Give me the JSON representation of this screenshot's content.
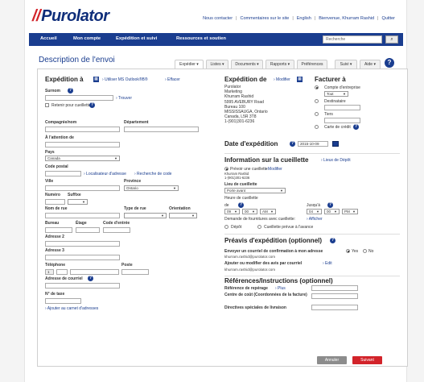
{
  "header": {
    "logo": "Purolator",
    "links": [
      "Nous contacter",
      "Commentaires sur le site",
      "English",
      "Bienvenue, Khurram Rashid",
      "Quitter"
    ]
  },
  "nav": {
    "items": [
      "Accueil",
      "Mon compte",
      "Expédition et suivi",
      "Ressources et soutien"
    ],
    "search_placeholder": "Recherche",
    "search_button": "⌕"
  },
  "page": {
    "title": "Description de l'envoi"
  },
  "tabs": [
    {
      "label": "Expédier ▾",
      "active": true
    },
    {
      "label": "Listes ▾"
    },
    {
      "label": "Documents ▾"
    },
    {
      "label": "Rapports ▾"
    },
    {
      "label": "Préférences"
    },
    {
      "label": "Suivi ▾"
    },
    {
      "label": "Aide ▾"
    }
  ],
  "left": {
    "title": "Expédition à",
    "use_outlook": "› Utiliser MS Outlook®B®",
    "effacer": "› Effacer",
    "surnom": "Surnom",
    "trouver": "› Trouver",
    "retenir": "Retenir pour cueillette",
    "compagnie": "Compagnie/nom",
    "departement": "Département",
    "attention": "À l'attention de",
    "pays": "Pays",
    "pays_value": "Canada",
    "code_postal": "Code postal",
    "localisateur": "› Localisateur d'adresse",
    "recherche_code": "› Recherche de code",
    "ville": "Ville",
    "province": "Province",
    "province_value": "Ontario",
    "numero": "Numéro",
    "suffixe": "Suffixe",
    "nom_rue": "Nom de rue",
    "type_rue": "Type de rue",
    "orientation": "Orientation",
    "bureau": "Bureau",
    "etage": "Étage",
    "code_entree": "Code d'entrée",
    "adresse2": "Adresse 2",
    "adresse3": "Adresse 3",
    "telephone": "Téléphone",
    "tel_prefix": "1",
    "poste": "Poste",
    "courriel": "Adresse de courriel",
    "taxe": "N° de taxe",
    "ajouter": "› Ajouter au carnet d'adresses"
  },
  "sender": {
    "title": "Expédition de",
    "modifier": "› Modifier",
    "address": "Purolator\nMarketing\nKhurram Rashid\n5995 AVEBURY Road\nBureau 100\nMISSISSAUGA, Ontario\nCanada, L5R 3T8\n1-(901)301-6236"
  },
  "billing": {
    "title": "Facturer à",
    "options": [
      "Compte d'entreprise",
      "Destinataire",
      "Tiers",
      "Carte de crédit"
    ],
    "tout": "Tout"
  },
  "date": {
    "title": "Date d'expédition",
    "value": "2015-10-09"
  },
  "pickup": {
    "title": "Information sur la cueillette",
    "lieux": "› Lieux de Dépôt",
    "prevoir": "Prévoir une cueillette",
    "modifier": "› Modifier",
    "contact": "Khurram Rashid\n1-(901)301-6236",
    "lieu": "Lieu de cueillette",
    "lieu_value": "Porte avant",
    "heure": "Heure de cueillette",
    "de": "de",
    "jusqua": "Jusqu'à",
    "time_from": [
      "09",
      "00",
      "AM"
    ],
    "time_to": [
      "04",
      "00",
      "PM"
    ],
    "demande": "Demande de fournitures avec cueillette:",
    "afficher": "› Afficher",
    "depot": "Dépôt",
    "cueillette_avance": "Cueillette prévue à l'avance"
  },
  "preavis": {
    "title": "Préavis d'expédition (optionnel)",
    "envoyer": "Envoyer un courriel de confirmation à mon adresse",
    "oui": "Yes",
    "non": "No",
    "email": "khurram.rashid@purolator.com",
    "ajouter": "Ajouter ou modifier des avis par courriel",
    "edit": "› Edit",
    "email2": "khurram.rashid@purolator.com"
  },
  "refs": {
    "title": "Références/Instructions (optionnel)",
    "reperage": "Référence de repérage",
    "plus": "› Plus",
    "centre": "Centre de coût (Coordonnées de la facture)",
    "directives": "Directives spéciales de livraison"
  },
  "buttons": {
    "annuler": "Annuler",
    "suivant": "Suivant"
  },
  "colors": {
    "brand": "#1a3d8f",
    "accent": "#d2232a"
  }
}
